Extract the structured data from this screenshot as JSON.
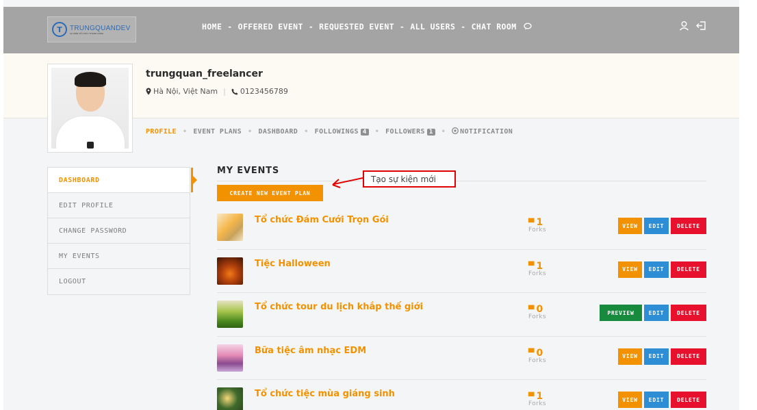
{
  "brand": {
    "logo_text": "TRUNGQUANDEV",
    "logo_tagline": "SỰ KIỆN TỔ CHỨC THÀNH CÔNG"
  },
  "nav": {
    "items": [
      "HOME",
      "OFFERED EVENT",
      "REQUESTED EVENT",
      "ALL USERS",
      "CHAT ROOM"
    ],
    "separator": "-",
    "chat_icon": "chat-bubble-icon",
    "right_icons": [
      "user-icon",
      "logout-icon"
    ]
  },
  "profile": {
    "username": "trungquan_freelancer",
    "location": "Hà Nội, Việt Nam",
    "phone": "0123456789"
  },
  "subnav": {
    "profile": "PROFILE",
    "event_plans": "EVENT PLANS",
    "dashboard": "DASHBOARD",
    "followings": "FOLLOWINGS",
    "followings_count": "4",
    "followers": "FOLLOWERS",
    "followers_count": "1",
    "notification": "NOTIFICATION"
  },
  "sidebar": {
    "items": [
      "DASHBOARD",
      "EDIT PROFILE",
      "CHANGE PASSWORD",
      "MY EVENTS",
      "LOGOUT"
    ],
    "active": "DASHBOARD"
  },
  "main": {
    "title": "MY EVENTS",
    "create_button": "CREATE NEW EVENT PLAN",
    "annotation": "Tạo sự kiện mới"
  },
  "events": [
    {
      "title": "Tổ chức Đám Cưới Trọn Gói",
      "forks": "1",
      "forks_label": "Forks",
      "primary": "VIEW",
      "edit": "EDIT",
      "delete": "DELETE"
    },
    {
      "title": "Tiệc Halloween",
      "forks": "1",
      "forks_label": "Forks",
      "primary": "VIEW",
      "edit": "EDIT",
      "delete": "DELETE"
    },
    {
      "title": "Tổ chức tour du lịch khắp thế giới",
      "forks": "0",
      "forks_label": "Forks",
      "primary": "PREVIEW",
      "edit": "EDIT",
      "delete": "DELETE"
    },
    {
      "title": "Bữa tiệc âm nhạc EDM",
      "forks": "0",
      "forks_label": "Forks",
      "primary": "VIEW",
      "edit": "EDIT",
      "delete": "DELETE"
    },
    {
      "title": "Tổ chức tiệc mùa giáng sinh",
      "forks": "1",
      "forks_label": "Forks",
      "primary": "VIEW",
      "edit": "EDIT",
      "delete": "DELETE"
    }
  ],
  "colors": {
    "accent": "#f39200",
    "view": "#f39200",
    "preview": "#178a3e",
    "edit": "#2d8ed6",
    "delete": "#e8112d",
    "annotation": "#e00000"
  }
}
